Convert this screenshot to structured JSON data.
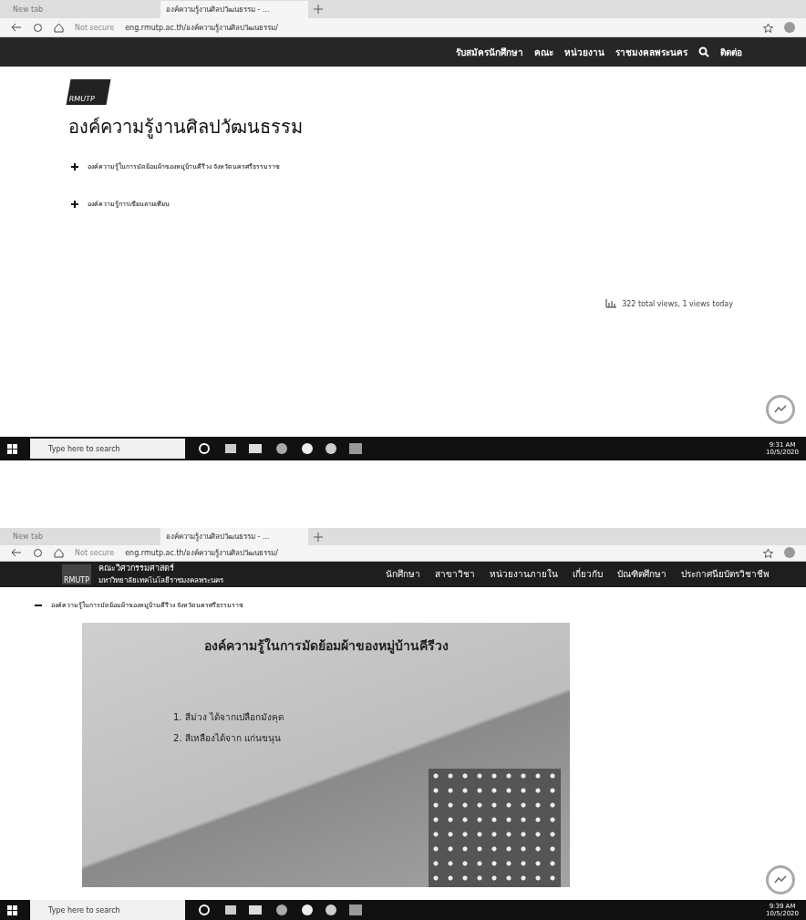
{
  "screenshot_1": {
    "tabs": [
      {
        "label": "New tab",
        "selected": false
      },
      {
        "label": "องค์ความรู้งานศิลปวัฒนธรรม - ...",
        "selected": true
      }
    ],
    "address": {
      "not_secure": "Not secure",
      "url": "eng.rmutp.ac.th/องค์ความรู้งานศิลปวัฒนธรรม/"
    },
    "nav": [
      "รับสมัครนักศึกษา",
      "คณะ",
      "หน่วยงาน",
      "ราชมงคลพระนคร",
      "ติดต่อ"
    ],
    "logo": "RMUTP",
    "heading": "องค์ความรู้งานศิลปวัฒนธรรม",
    "items": [
      {
        "label": "องค์ความรู้ในการมัดย้อมผ้าของหมู่บ้านคีรีวง จังหวัดนครศรีธรรมราช",
        "expanded": false
      },
      {
        "label": "องค์ความรู้การเขียนลายเทียน",
        "expanded": false
      }
    ],
    "views": "322 total views, 1 views today",
    "taskbar": {
      "search": "Type here to search",
      "time": "9:31 AM",
      "date": "10/5/2020"
    }
  },
  "screenshot_2": {
    "tabs": [
      {
        "label": "New tab",
        "selected": false
      },
      {
        "label": "องค์ความรู้งานศิลปวัฒนธรรม - ...",
        "selected": true
      }
    ],
    "address": {
      "not_secure": "Not secure",
      "url": "eng.rmutp.ac.th/องค์ความรู้งานศิลปวัฒนธรรม/"
    },
    "logo": {
      "mark": "RMUTP",
      "title": "คณะวิศวกรรมศาสตร์",
      "subtitle": "มหาวิทยาลัยเทคโนโลยีราชมงคลพระนคร"
    },
    "nav": [
      "นักศึกษา",
      "สาขาวิชา",
      "หน่วยงานภายใน",
      "เกี่ยวกับ",
      "บัณฑิตศึกษา",
      "ประกาศนียบัตรวิชาชีพ"
    ],
    "item": {
      "label": "องค์ความรู้ในการมัดย้อมผ้าของหมู่บ้านคีรีวง จังหวัดนครศรีธรรมราช",
      "expanded": true
    },
    "slide": {
      "title": "องค์ความรู้ในการมัดย้อมผ้าของหมู่บ้านคีรีวง",
      "lines": [
        "1. สีม่วง ได้จากเปลือกมังคุด",
        "2. สีเหลืองได้จาก แก่นขนุน"
      ]
    },
    "taskbar": {
      "search": "Type here to search",
      "time": "9:39 AM",
      "date": "10/5/2020"
    }
  }
}
